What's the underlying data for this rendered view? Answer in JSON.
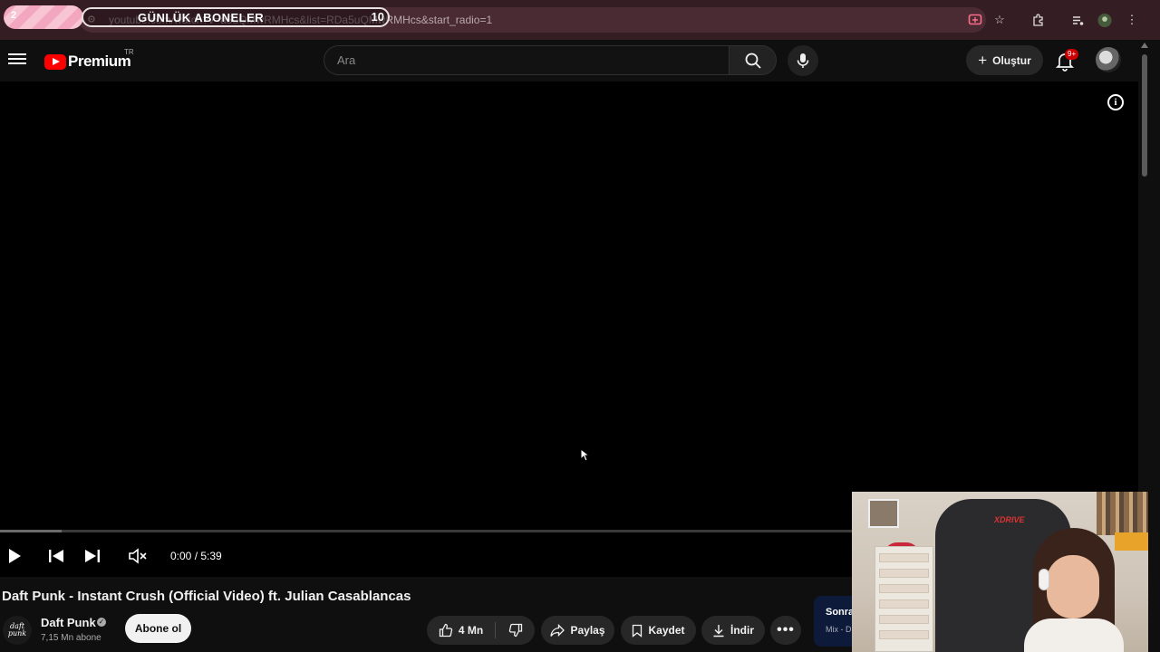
{
  "browser": {
    "url": "youtube.com/watch?v=a5uQMwRMHcs&list=RDa5uQMwRMHcs&start_radio=1",
    "overlay_title": "GÜNLÜK ABONELER",
    "overlay_count": "10",
    "overlay_left_num": "2"
  },
  "header": {
    "logo_text": "Premium",
    "region": "TR",
    "search_placeholder": "Ara",
    "create_label": "Oluştur",
    "notification_count": "9+"
  },
  "player": {
    "time": "0:00 / 5:39",
    "progress_fraction": 0,
    "buffered_fraction": 0.072
  },
  "video": {
    "title": "Daft Punk - Instant Crush (Official Video) ft. Julian Casablancas",
    "channel_name": "Daft Punk",
    "channel_avatar_text": "daft punk",
    "subscribers": "7,15 Mn abone",
    "subscribe_label": "Abone ol",
    "likes": "4 Mn",
    "share_label": "Paylaş",
    "save_label": "Kaydet",
    "download_label": "İndir"
  },
  "up_next": {
    "line1": "Sonra",
    "line2": "Mix - D"
  },
  "webcam": {
    "chair_brand": "XDRIVE"
  },
  "colors": {
    "brand_red": "#ff0000",
    "background": "#0f0f0f",
    "chrome_bar": "#351d24"
  }
}
